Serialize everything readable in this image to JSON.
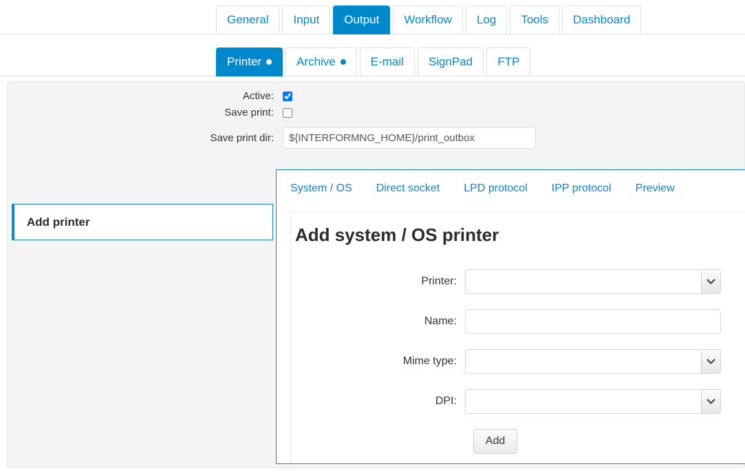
{
  "main_tabs": [
    {
      "label": "General",
      "active": false
    },
    {
      "label": "Input",
      "active": false
    },
    {
      "label": "Output",
      "active": true
    },
    {
      "label": "Workflow",
      "active": false
    },
    {
      "label": "Log",
      "active": false
    },
    {
      "label": "Tools",
      "active": false
    },
    {
      "label": "Dashboard",
      "active": false
    }
  ],
  "sub_tabs": [
    {
      "label": "Printer",
      "active": true,
      "dot": true
    },
    {
      "label": "Archive",
      "active": false,
      "dot": true
    },
    {
      "label": "E-mail",
      "active": false,
      "dot": false
    },
    {
      "label": "SignPad",
      "active": false,
      "dot": false
    },
    {
      "label": "FTP",
      "active": false,
      "dot": false
    }
  ],
  "printer_settings": {
    "active_label": "Active:",
    "active_checked": true,
    "save_print_label": "Save print:",
    "save_print_checked": false,
    "save_print_dir_label": "Save print dir:",
    "save_print_dir_value": "${INTERFORMNG_HOME}/print_outbox"
  },
  "add_printer_panel": {
    "header": "Add printer"
  },
  "printer_type": {
    "tabs": [
      {
        "label": "System / OS"
      },
      {
        "label": "Direct socket"
      },
      {
        "label": "LPD protocol"
      },
      {
        "label": "IPP protocol"
      },
      {
        "label": "Preview"
      }
    ],
    "title": "Add system / OS printer",
    "fields": [
      {
        "label": "Printer:",
        "type": "select",
        "value": ""
      },
      {
        "label": "Name:",
        "type": "text",
        "value": ""
      },
      {
        "label": "Mime type:",
        "type": "select",
        "value": ""
      },
      {
        "label": "DPI:",
        "type": "select",
        "value": ""
      }
    ],
    "add_button_label": "Add"
  },
  "colors": {
    "accent": "#0088cc",
    "panel_border": "#1187c9",
    "page_bg": "#f4f4f4"
  }
}
